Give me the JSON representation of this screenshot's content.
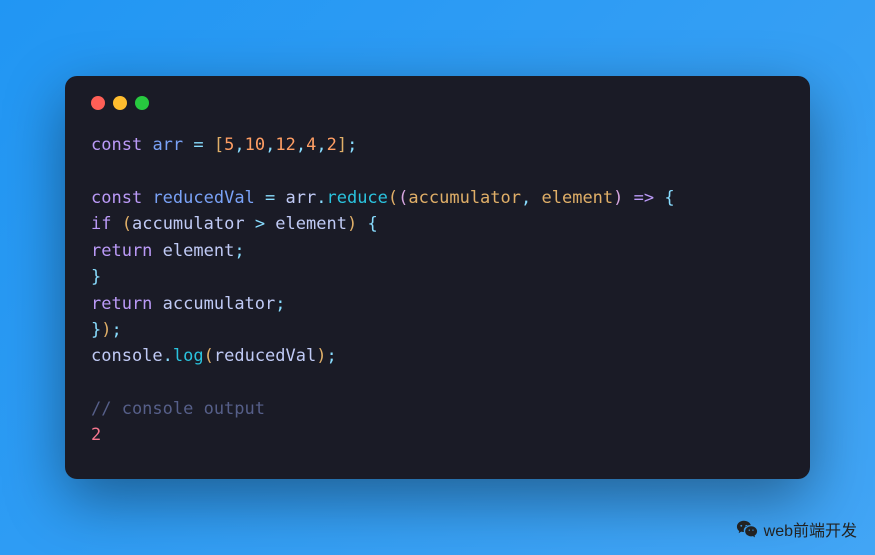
{
  "code": {
    "l1_const": "const",
    "l1_arr": "arr",
    "l1_eq": " = ",
    "l1_lb": "[",
    "l1_n1": "5",
    "l1_c1": ",",
    "l1_n2": "10",
    "l1_c2": ",",
    "l1_n3": "12",
    "l1_c3": ",",
    "l1_n4": "4",
    "l1_c4": ",",
    "l1_n5": "2",
    "l1_rb": "]",
    "l1_sc": ";",
    "l3_const": "const",
    "l3_rv": "reducedVal",
    "l3_eq": " = ",
    "l3_arr": "arr",
    "l3_dot": ".",
    "l3_reduce": "reduce",
    "l3_lp1": "(",
    "l3_lp2": "(",
    "l3_acc": "accumulator",
    "l3_c1": ",",
    "l3_sp": " ",
    "l3_elem": "element",
    "l3_rp2": ")",
    "l3_arrow": " => ",
    "l3_lb": "{",
    "l4_if": "if",
    "l4_sp": " ",
    "l4_lp": "(",
    "l4_acc": "accumulator",
    "l4_gt": " > ",
    "l4_elem": "element",
    "l4_rp": ")",
    "l4_sp2": " ",
    "l4_lb": "{",
    "l5_return": "return",
    "l5_sp": " ",
    "l5_elem": "element",
    "l5_sc": ";",
    "l6_rb": "}",
    "l7_return": "return",
    "l7_sp": " ",
    "l7_acc": "accumulator",
    "l7_sc": ";",
    "l8_rb": "}",
    "l8_rp": ")",
    "l8_sc": ";",
    "l9_console": "console",
    "l9_dot": ".",
    "l9_log": "log",
    "l9_lp": "(",
    "l9_rv": "reducedVal",
    "l9_rp": ")",
    "l9_sc": ";",
    "l11_comment": "// console output",
    "l12_out": "2"
  },
  "watermark": {
    "text": "web前端开发"
  }
}
